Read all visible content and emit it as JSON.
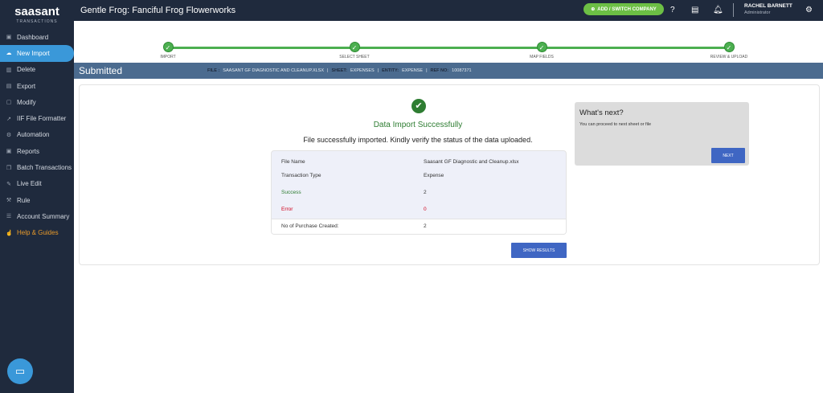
{
  "sidebar": {
    "logo": "saasant",
    "logo_sub": "TRANSACTIONS",
    "items": [
      {
        "label": "Dashboard",
        "icon": "dashboard-icon",
        "glyph": "▣"
      },
      {
        "label": "New Import",
        "icon": "cloud-upload-icon",
        "glyph": "☁"
      },
      {
        "label": "Delete",
        "icon": "trash-icon",
        "glyph": "▥"
      },
      {
        "label": "Export",
        "icon": "export-icon",
        "glyph": "▤"
      },
      {
        "label": "Modify",
        "icon": "file-edit-icon",
        "glyph": "▢"
      },
      {
        "label": "IIF File Formatter",
        "icon": "external-link-icon",
        "glyph": "↗"
      },
      {
        "label": "Automation",
        "icon": "gears-icon",
        "glyph": "⚙"
      },
      {
        "label": "Reports",
        "icon": "reports-icon",
        "glyph": "▣"
      },
      {
        "label": "Batch Transactions",
        "icon": "copy-icon",
        "glyph": "❐"
      },
      {
        "label": "Live Edit",
        "icon": "pencil-icon",
        "glyph": "✎"
      },
      {
        "label": "Rule",
        "icon": "gavel-icon",
        "glyph": "⚒"
      },
      {
        "label": "Account Summary",
        "icon": "list-icon",
        "glyph": "☰"
      },
      {
        "label": "Help & Guides",
        "icon": "thumbs-up-icon",
        "glyph": "☝"
      }
    ]
  },
  "header": {
    "title": "Gentle Frog: Fanciful Frog Flowerworks",
    "add_company": "ADD / SWITCH COMPANY",
    "user_name": "RACHEL BARNETT",
    "user_role": "Administrator"
  },
  "steps": [
    "IMPORT",
    "SELECT SHEET",
    "MAP FIELDS",
    "REVIEW & UPLOAD"
  ],
  "status_bar": {
    "title": "Submitted",
    "file_label": "FILE :",
    "file": "SAASANT GF DIAGNOSTIC AND CLEANUP.XLSX",
    "sheet_label": "SHEET:",
    "sheet": "EXPENSES",
    "entity_label": "ENTITY:",
    "entity": "EXPENSE",
    "ref_label": "REF NO:",
    "ref": "10087371"
  },
  "result": {
    "heading": "Data Import Successfully",
    "message": "File successfully imported. Kindly verify the status of the data uploaded.",
    "rows": [
      {
        "label": "File Name",
        "value": "Saasant GF Diagnostic and Cleanup.xlsx"
      },
      {
        "label": "Transaction Type",
        "value": "Expense"
      },
      {
        "label": "Success",
        "value": "2"
      },
      {
        "label": "Error",
        "value": "0"
      },
      {
        "label": "No of Purchase Created:",
        "value": "2"
      }
    ],
    "show_results": "SHOW RESULTS"
  },
  "next": {
    "title": "What's next?",
    "text": "You can proceed to next sheet or file",
    "button": "NEXT"
  },
  "colors": {
    "success": "#2e7d32",
    "error": "#d0021b",
    "accent": "#3f66c3",
    "sidebar": "#1f2a3d"
  }
}
